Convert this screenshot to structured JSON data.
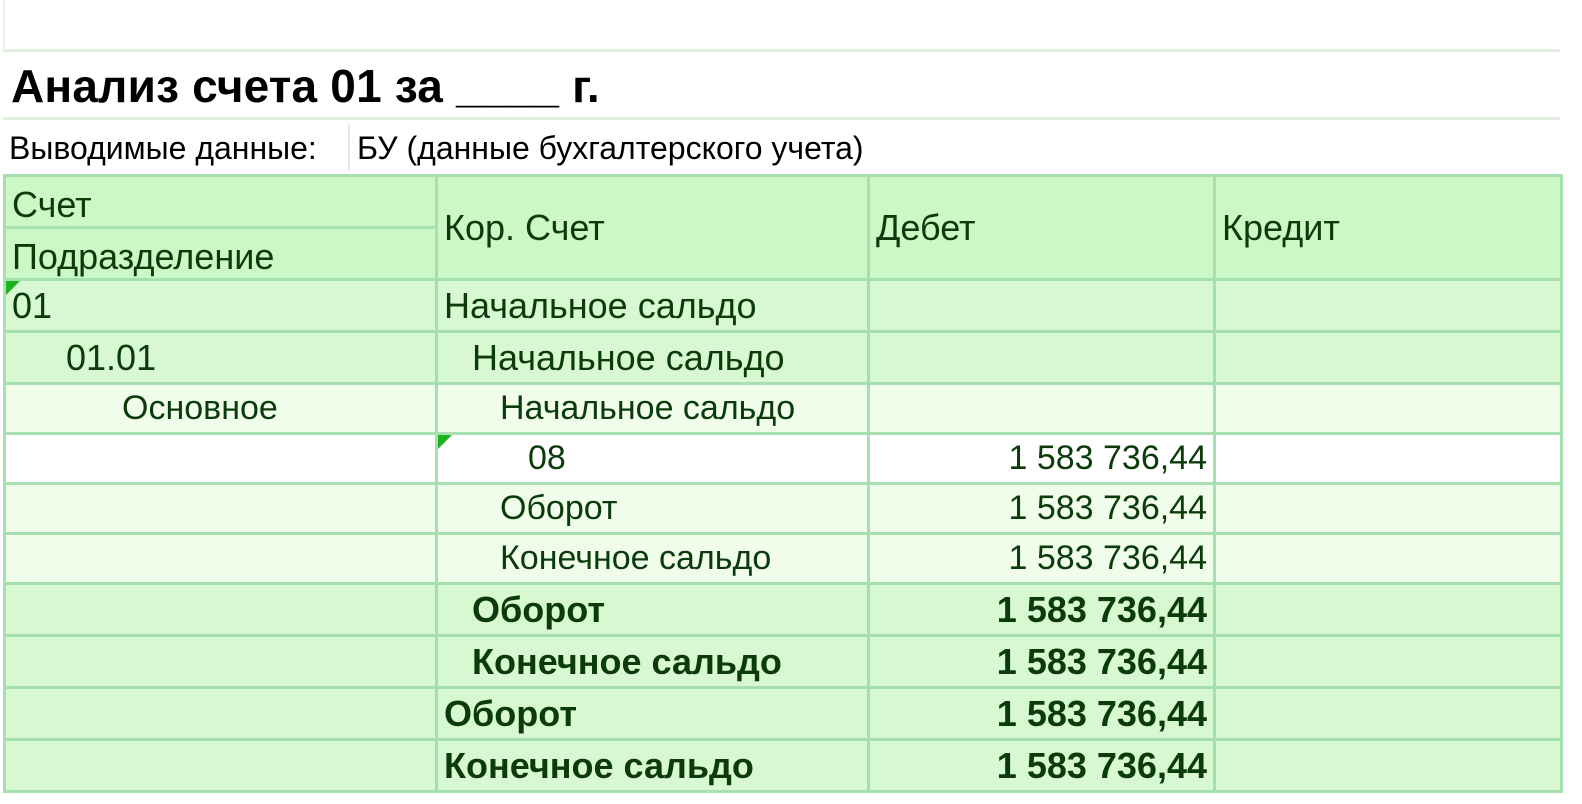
{
  "report": {
    "title": "Анализ счета 01 за ____ г.",
    "params_label": "Выводимые данные:",
    "params_value": "БУ (данные бухгалтерского учета)"
  },
  "columns": {
    "account": "Счет",
    "subdivision": "Подразделение",
    "corr_account": "Кор. Счет",
    "debit": "Дебет",
    "credit": "Кредит"
  },
  "rows": [
    {
      "account": "01",
      "corr": "Начальное сальдо",
      "debit": "",
      "credit": ""
    },
    {
      "account": "01.01",
      "corr": "Начальное сальдо",
      "debit": "",
      "credit": ""
    },
    {
      "account": "Основное",
      "corr": "Начальное сальдо",
      "debit": "",
      "credit": ""
    },
    {
      "account": "",
      "corr": "08",
      "debit": "1 583 736,44",
      "credit": ""
    },
    {
      "account": "",
      "corr": "Оборот",
      "debit": "1 583 736,44",
      "credit": ""
    },
    {
      "account": "",
      "corr": "Конечное сальдо",
      "debit": "1 583 736,44",
      "credit": ""
    },
    {
      "account": "",
      "corr": "Оборот",
      "debit": "1 583 736,44",
      "credit": ""
    },
    {
      "account": "",
      "corr": "Конечное сальдо",
      "debit": "1 583 736,44",
      "credit": ""
    },
    {
      "account": "",
      "corr": "Оборот",
      "debit": "1 583 736,44",
      "credit": ""
    },
    {
      "account": "",
      "corr": "Конечное сальдо",
      "debit": "1 583 736,44",
      "credit": ""
    }
  ]
}
